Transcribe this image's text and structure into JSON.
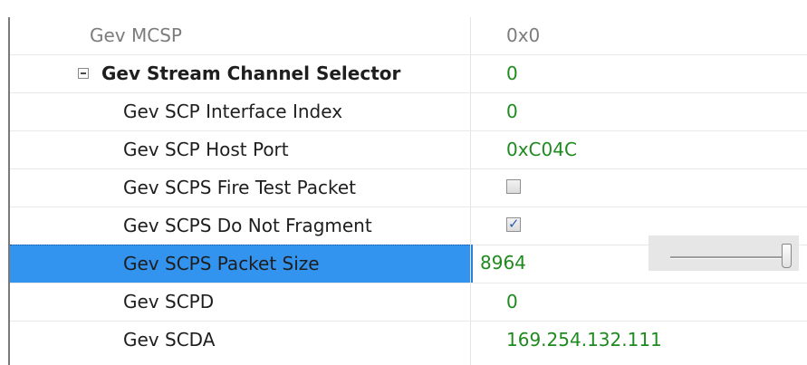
{
  "property_grid": {
    "rows": [
      {
        "name": "Gev MCSP",
        "value": "0x0"
      },
      {
        "name": "Gev Stream Channel Selector",
        "value": "0"
      },
      {
        "name": "Gev SCP Interface Index",
        "value": "0"
      },
      {
        "name": "Gev SCP Host Port",
        "value": "0xC04C"
      },
      {
        "name": "Gev SCPS Fire Test Packet",
        "value": "",
        "checked": false
      },
      {
        "name": "Gev SCPS Do Not Fragment",
        "value": "",
        "checked": true
      },
      {
        "name": "Gev SCPS Packet Size",
        "value": "8964",
        "slider_level": 1.0
      },
      {
        "name": "Gev SCPD",
        "value": "0"
      },
      {
        "name": "Gev SCDA",
        "value": "169.254.132.111"
      }
    ],
    "checkmark_glyph": "✓"
  },
  "colors": {
    "value_text": "#1f8a1f",
    "selected_row": "#3394f0",
    "disabled_text": "#7c7c7c"
  },
  "icons": {
    "expander": "collapse-minus-icon",
    "checkbox": "checkbox-icon"
  }
}
